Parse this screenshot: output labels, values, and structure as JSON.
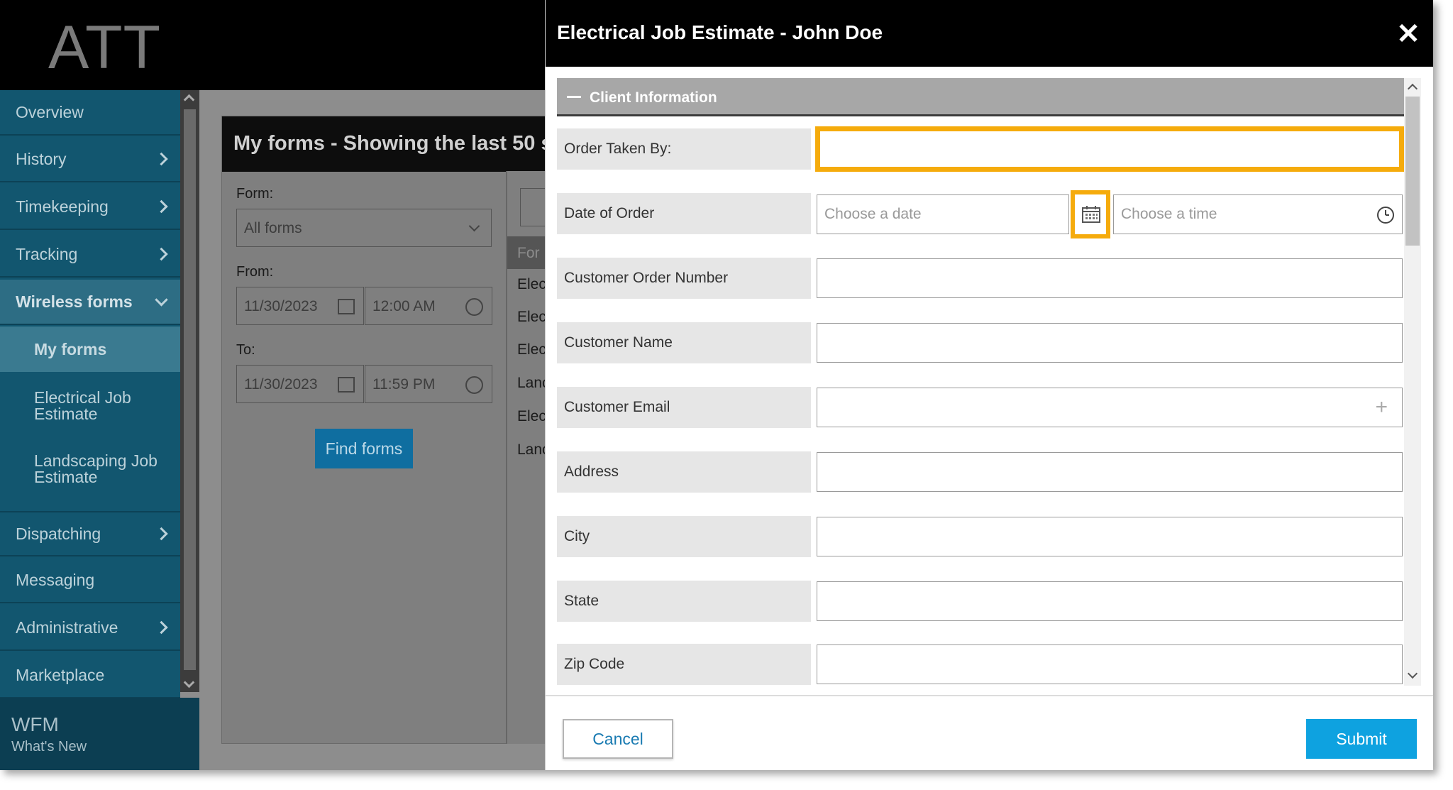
{
  "app": {
    "logo": "ATT"
  },
  "sidebar": {
    "items": [
      {
        "label": "Overview"
      },
      {
        "label": "History"
      },
      {
        "label": "Timekeeping"
      },
      {
        "label": "Tracking"
      },
      {
        "label": "Wireless forms"
      },
      {
        "label": "Dispatching"
      },
      {
        "label": "Messaging"
      },
      {
        "label": "Administrative"
      },
      {
        "label": "Marketplace"
      }
    ],
    "sub_items": [
      {
        "label": "My forms"
      },
      {
        "label": "Electrical Job Estimate"
      },
      {
        "label": "Landscaping Job Estimate"
      }
    ],
    "footer": {
      "title": "WFM",
      "subtitle": "What's New"
    }
  },
  "forms_panel": {
    "title": "My forms - Showing the last 50 s",
    "form_label": "Form:",
    "form_value": "All forms",
    "from_label": "From:",
    "from_date": "11/30/2023",
    "from_time": "12:00 AM",
    "to_label": "To:",
    "to_date": "11/30/2023",
    "to_time": "11:59 PM",
    "find_button": "Find forms",
    "results_header": "For",
    "results_rows": [
      "Elec",
      "Elec",
      "Elec",
      "Lanc",
      "Elec",
      "Lanc"
    ]
  },
  "modal": {
    "title": "Electrical Job Estimate - John Doe",
    "section_title": "Client Information",
    "fields": [
      {
        "label": "Order Taken By:",
        "value": ""
      },
      {
        "label": "Date of Order",
        "date_placeholder": "Choose a date",
        "time_placeholder": "Choose a time"
      },
      {
        "label": "Customer Order Number",
        "value": ""
      },
      {
        "label": "Customer Name",
        "value": ""
      },
      {
        "label": "Customer Email",
        "value": ""
      },
      {
        "label": "Address",
        "value": ""
      },
      {
        "label": "City",
        "value": ""
      },
      {
        "label": "State",
        "value": ""
      },
      {
        "label": "Zip Code",
        "value": ""
      }
    ],
    "cancel_label": "Cancel",
    "submit_label": "Submit"
  },
  "colors": {
    "highlight": "#f5ab0c",
    "submit": "#0ea2e0",
    "sidebar": "#12566f",
    "header": "#000000"
  }
}
